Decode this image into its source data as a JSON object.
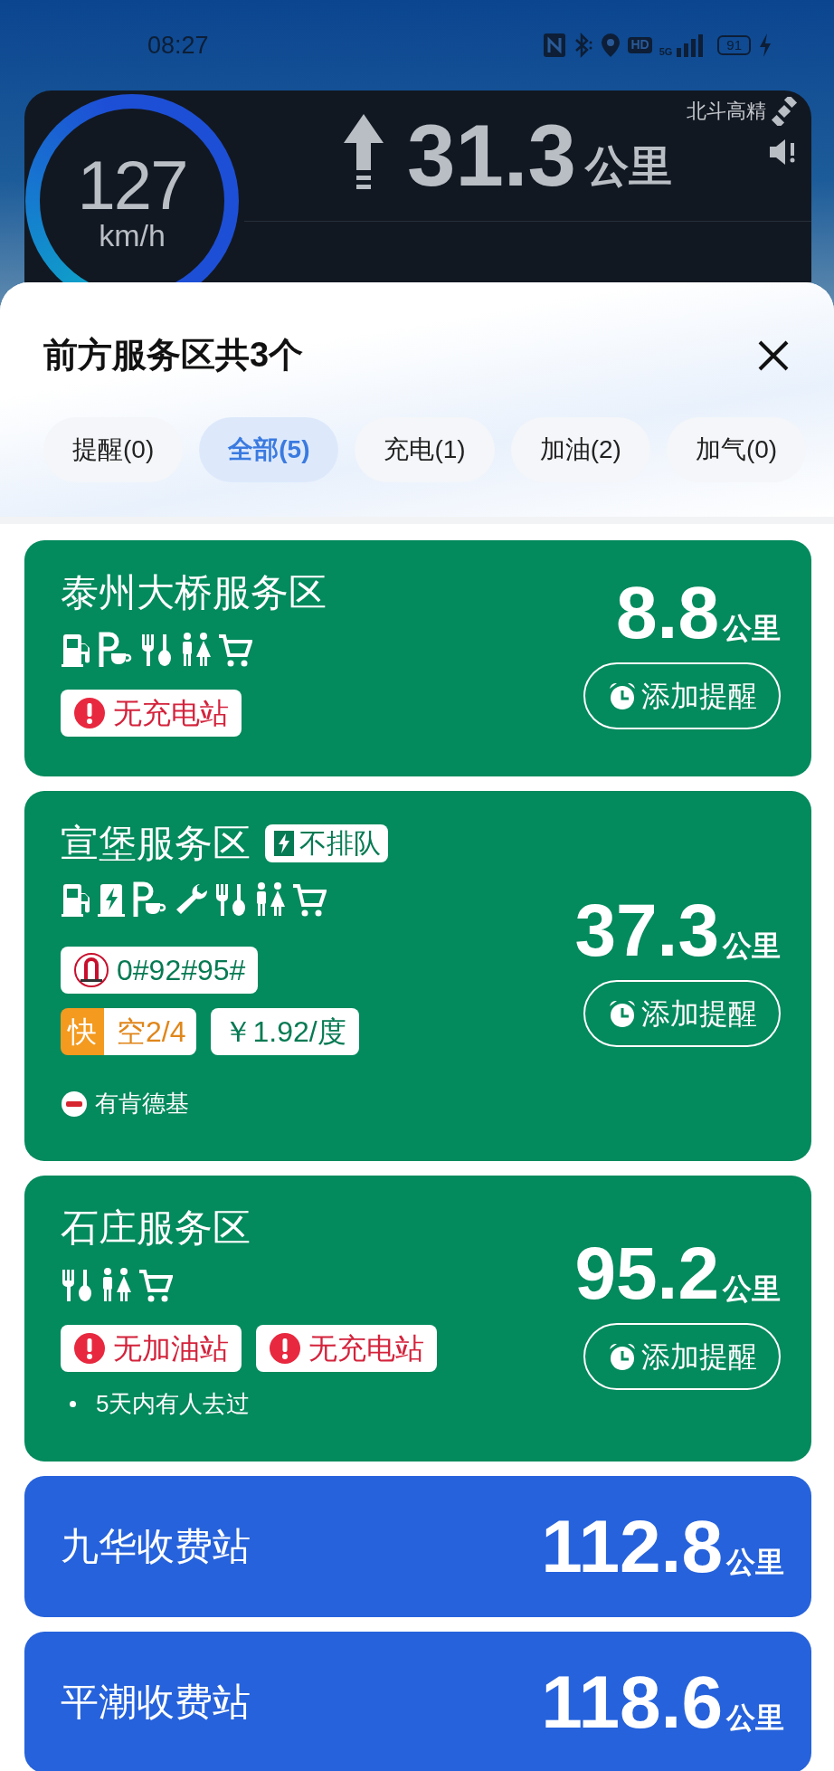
{
  "status_bar": {
    "time": "08:27",
    "hd": "HD",
    "network": "5G",
    "battery": "91"
  },
  "navigation": {
    "speed": "127",
    "speed_unit": "km/h",
    "distance": "31.3",
    "distance_unit": "公里",
    "positioning": "北斗高精"
  },
  "sheet": {
    "title": "前方服务区共3个",
    "tabs": [
      {
        "label": "提醒(0)",
        "selected": false
      },
      {
        "label": "全部(5)",
        "selected": true
      },
      {
        "label": "充电(1)",
        "selected": false
      },
      {
        "label": "加油(2)",
        "selected": false
      },
      {
        "label": "加气(0)",
        "selected": false
      }
    ]
  },
  "stations": [
    {
      "kind": "service_area",
      "name": "泰州大桥服务区",
      "amenities": [
        {
          "kind": "gas"
        },
        {
          "kind": "parking_cafe"
        },
        {
          "kind": "dining"
        },
        {
          "kind": "restroom"
        },
        {
          "kind": "shopping"
        }
      ],
      "warnings": [
        "无充电站"
      ],
      "distance": "8.8",
      "unit": "公里",
      "button": "添加提醒"
    },
    {
      "kind": "service_area",
      "name": "宣堡服务区",
      "badge": "不排队",
      "amenities": [
        {
          "kind": "gas"
        },
        {
          "kind": "charge"
        },
        {
          "kind": "parking_cafe"
        },
        {
          "kind": "repair"
        },
        {
          "kind": "dining"
        },
        {
          "kind": "restroom"
        },
        {
          "kind": "shopping"
        }
      ],
      "fuel": "0#92#95#",
      "charger": {
        "speed": "快",
        "availability": "空2/4",
        "price": "￥1.92/度"
      },
      "note": {
        "kind": "kfc",
        "text": "有肯德基"
      },
      "distance": "37.3",
      "unit": "公里",
      "button": "添加提醒"
    },
    {
      "kind": "service_area",
      "name": "石庄服务区",
      "amenities": [
        {
          "kind": "dining"
        },
        {
          "kind": "restroom"
        },
        {
          "kind": "shopping"
        }
      ],
      "warnings": [
        "无加油站",
        "无充电站"
      ],
      "note": {
        "kind": "dot",
        "text": "5天内有人去过"
      },
      "distance": "95.2",
      "unit": "公里",
      "button": "添加提醒"
    },
    {
      "kind": "toll",
      "name": "九华收费站",
      "distance": "112.8",
      "unit": "公里"
    },
    {
      "kind": "toll",
      "name": "平潮收费站",
      "distance": "118.6",
      "unit": "公里"
    }
  ]
}
